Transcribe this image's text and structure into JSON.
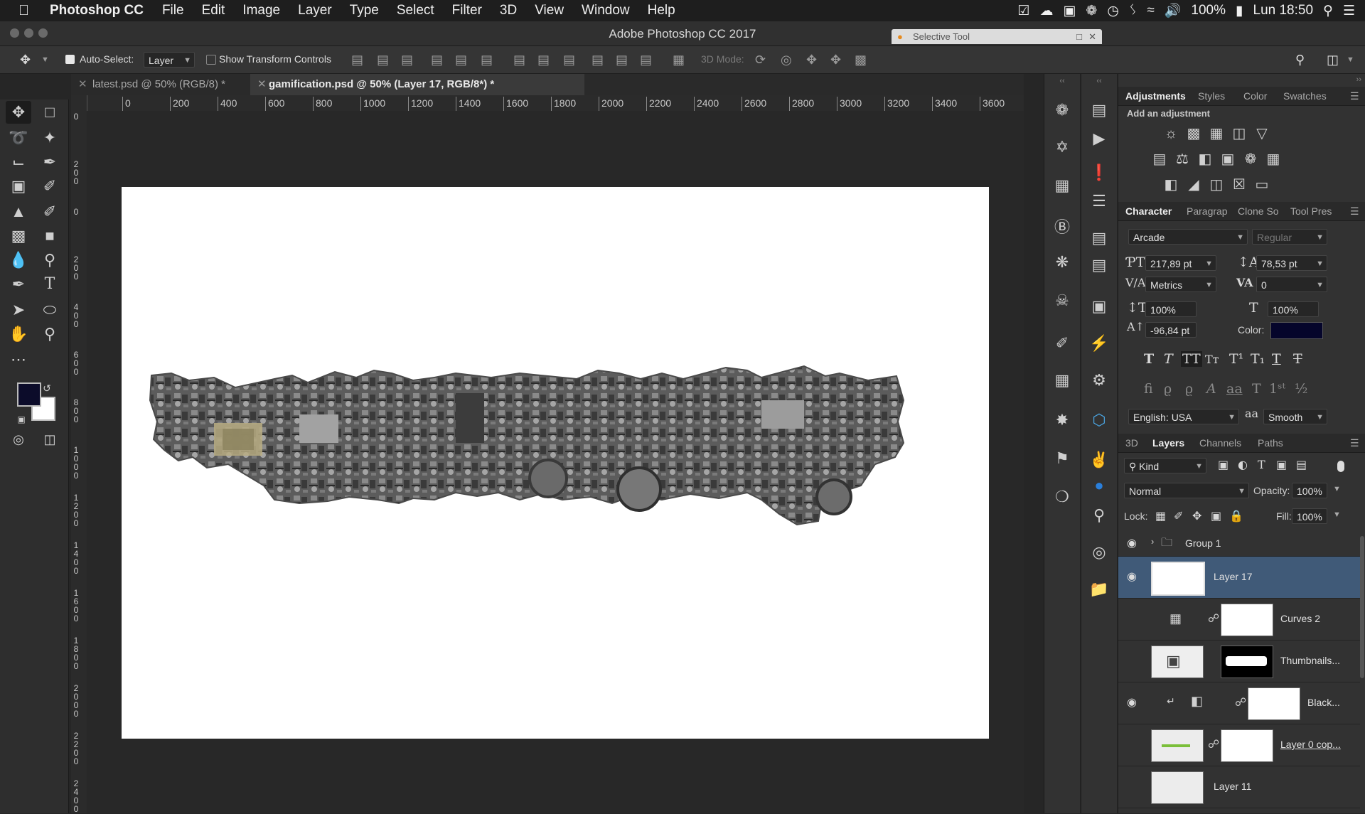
{
  "menubar": {
    "app_name": "Photoshop CC",
    "items": [
      "File",
      "Edit",
      "Image",
      "Layer",
      "Type",
      "Select",
      "Filter",
      "3D",
      "View",
      "Window",
      "Help"
    ],
    "battery": "100%",
    "clock": "Lun 18:50"
  },
  "window": {
    "title": "Adobe Photoshop CC 2017",
    "selective_tool_label": "Selective Tool"
  },
  "options": {
    "auto_select_label": "Auto-Select:",
    "auto_select_value": "Layer",
    "show_transform_label": "Show Transform Controls",
    "mode_3d_label": "3D Mode:"
  },
  "tabs": [
    {
      "label": "latest.psd @ 50% (RGB/8) *"
    },
    {
      "label": "gamification.psd @ 50% (Layer 17, RGB/8*) *"
    }
  ],
  "ruler": {
    "top_ticks": [
      "0",
      "200",
      "400",
      "600",
      "800",
      "1000",
      "1200",
      "1400",
      "1600",
      "1800",
      "2000",
      "2200",
      "2400",
      "2600",
      "2800",
      "3000",
      "3200",
      "3400",
      "3600"
    ],
    "left_ticks": [
      "0",
      "2\n0\n0",
      "0",
      "2\n0\n0",
      "4\n0\n0",
      "6\n0\n0",
      "8\n0\n0",
      "1\n0\n0\n0",
      "1\n2\n0\n0",
      "1\n4\n0\n0",
      "1\n6\n0\n0",
      "1\n8\n0\n0",
      "2\n0\n0\n0",
      "2\n2\n0\n0",
      "2\n4\n0\n0"
    ]
  },
  "colors": {
    "foreground": "#0c0c2a",
    "background": "#ffffff",
    "selected_layer": "#405a78",
    "text_color_swatch": "#05052b"
  },
  "adjustments": {
    "tabs": [
      "Adjustments",
      "Styles",
      "Color",
      "Swatches"
    ],
    "heading": "Add an adjustment"
  },
  "character": {
    "tabs": [
      "Character",
      "Paragrap",
      "Clone So",
      "Tool Pres"
    ],
    "font_family": "Arcade",
    "font_style": "Regular",
    "font_size": "217,89 pt",
    "leading": "78,53 pt",
    "kerning": "Metrics",
    "tracking": "0",
    "vertical_scale": "100%",
    "horizontal_scale": "100%",
    "baseline_shift": "-96,84 pt",
    "color_label": "Color:",
    "language": "English: USA",
    "antialias_label": "aa",
    "antialias": "Smooth"
  },
  "layers": {
    "tabs": [
      "3D",
      "Layers",
      "Channels",
      "Paths"
    ],
    "filter_kind": "Kind",
    "blend_mode": "Normal",
    "opacity_label": "Opacity:",
    "opacity": "100%",
    "lock_label": "Lock:",
    "fill_label": "Fill:",
    "fill": "100%",
    "rows": [
      {
        "name": "Group 1"
      },
      {
        "name": "Layer 17"
      },
      {
        "name": "Curves 2"
      },
      {
        "name": "Thumbnails..."
      },
      {
        "name": "Black..."
      },
      {
        "name": "Layer 0 cop..."
      },
      {
        "name": "Layer 11"
      }
    ]
  }
}
